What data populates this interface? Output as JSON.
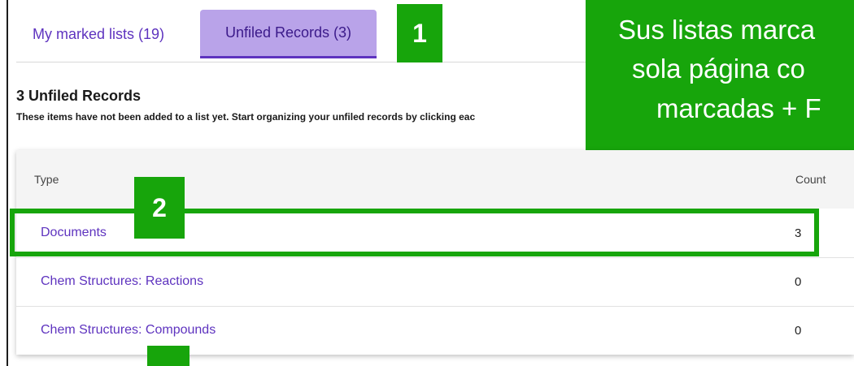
{
  "tabs": [
    {
      "label": "My marked lists (19)"
    },
    {
      "label": "Unfiled Records (3)"
    }
  ],
  "callouts": {
    "one": "1",
    "two": "2"
  },
  "banner": {
    "line1": "Sus listas marca",
    "line2": "sola página co",
    "line3": "marcadas + F"
  },
  "section": {
    "heading": "3 Unfiled Records",
    "description": "These items have not been added to a list yet. Start organizing your unfiled records by clicking eac"
  },
  "table": {
    "columns": {
      "type": "Type",
      "count": "Count"
    },
    "rows": [
      {
        "type": "Documents",
        "count": "3"
      },
      {
        "type": "Chem Structures: Reactions",
        "count": "0"
      },
      {
        "type": "Chem Structures: Compounds",
        "count": "0"
      }
    ]
  },
  "colors": {
    "accent": "#5e33bf",
    "active_tab_bg": "#b9a3e9",
    "callout_green": "#17a50b"
  }
}
